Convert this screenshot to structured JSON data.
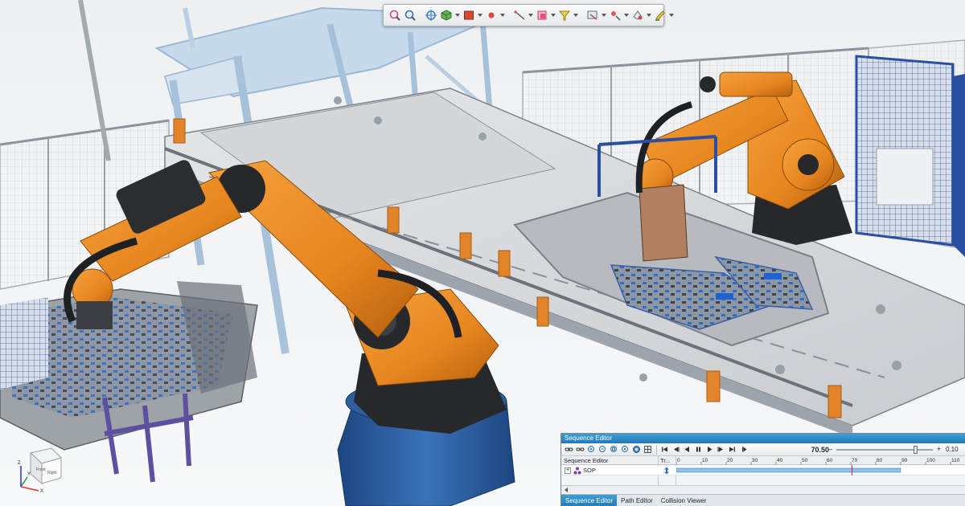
{
  "toolbar": {
    "icons": [
      "zoom-area-icon",
      "zoom-icon",
      "fit-view-icon",
      "view-cube-icon",
      "render-mode-icon",
      "point-icon",
      "measure-icon",
      "section-icon",
      "selection-icon",
      "display-icon",
      "snap-icon",
      "settings-icon",
      "paint-icon"
    ]
  },
  "navcube": {
    "face_right": "Right",
    "face_front": "Front",
    "axis_x": "X",
    "axis_y": "Y",
    "axis_z": "Z"
  },
  "sequence_editor": {
    "title": "Sequence Editor",
    "time_value": "70.50",
    "zoom_value": "0.10",
    "zoom_minus": "–",
    "zoom_plus": "+",
    "column_name": "Sequence Editor",
    "column_tr": "Tr...",
    "row": {
      "expand": "+",
      "label": "SOP"
    },
    "ruler_ticks": [
      "0",
      "10",
      "20",
      "30",
      "40",
      "50",
      "60",
      "70",
      "80",
      "90",
      "100",
      "110"
    ],
    "tabs": [
      {
        "label": "Sequence Editor",
        "active": true
      },
      {
        "label": "Path Editor",
        "active": false
      },
      {
        "label": "Collision Viewer",
        "active": false
      }
    ],
    "current_time": 70.5,
    "total_end": 90
  },
  "colors": {
    "robot_orange": "#e8861f",
    "robot_black": "#26282b",
    "robot_base_blue": "#2e5e9c",
    "frame_blue": "#2a4fa0",
    "accent_blue": "#2378b5"
  }
}
